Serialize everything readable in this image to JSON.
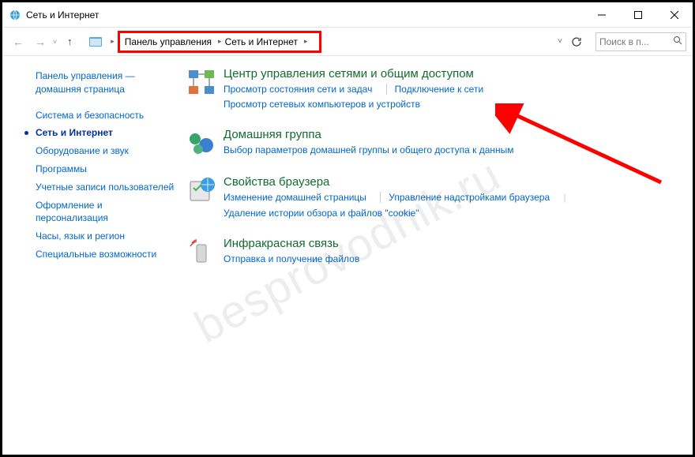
{
  "window": {
    "title": "Сеть и Интернет"
  },
  "breadcrumb": {
    "items": [
      "Панель управления",
      "Сеть и Интернет"
    ]
  },
  "search": {
    "placeholder": "Поиск в п..."
  },
  "sidebar": {
    "home": "Панель управления — домашняя страница",
    "items": [
      "Система и безопасность",
      "Сеть и Интернет",
      "Оборудование и звук",
      "Программы",
      "Учетные записи пользователей",
      "Оформление и персонализация",
      "Часы, язык и регион",
      "Специальные возможности"
    ],
    "current_index": 1
  },
  "categories": [
    {
      "title": "Центр управления сетями и общим доступом",
      "links": [
        "Просмотр состояния сети и задач",
        "Подключение к сети",
        "Просмотр сетевых компьютеров и устройств"
      ]
    },
    {
      "title": "Домашняя группа",
      "links": [
        "Выбор параметров домашней группы и общего доступа к данным"
      ]
    },
    {
      "title": "Свойства браузера",
      "links": [
        "Изменение домашней страницы",
        "Управление надстройками браузера",
        "Удаление истории обзора и файлов \"cookie\""
      ]
    },
    {
      "title": "Инфракрасная связь",
      "links": [
        "Отправка и получение файлов"
      ]
    }
  ],
  "watermark": "besprovodnik.ru"
}
